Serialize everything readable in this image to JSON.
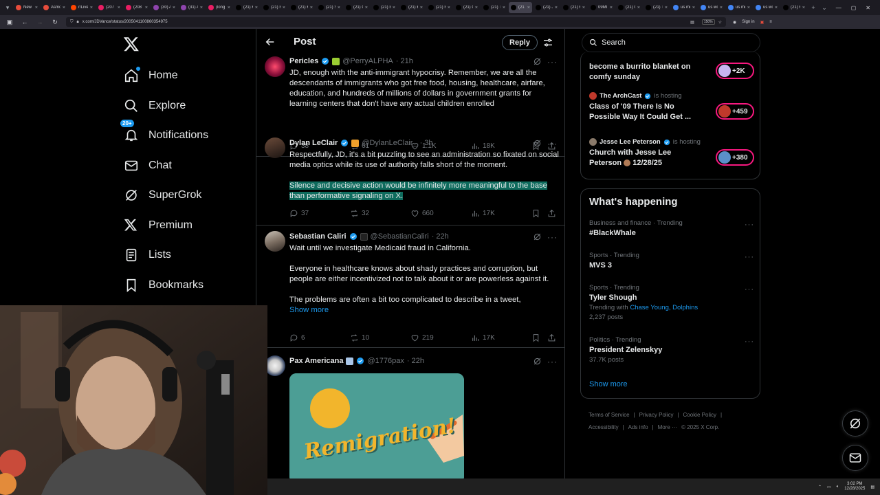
{
  "browser": {
    "tabs": [
      {
        "label": "New",
        "color": "#e74c3c"
      },
      {
        "label": "Asmo",
        "color": "#e74c3c"
      },
      {
        "label": "r/Live",
        "color": "#ff4500"
      },
      {
        "label": "(207",
        "color": "#e91e63"
      },
      {
        "label": "(208",
        "color": "#e91e63"
      },
      {
        "label": "(30) A",
        "color": "#8e44ad"
      },
      {
        "label": "(31) A",
        "color": "#8e44ad"
      },
      {
        "label": "(long",
        "color": "#e91e63"
      },
      {
        "label": "(21) F",
        "color": "#000000"
      },
      {
        "label": "(21) F",
        "color": "#000000"
      },
      {
        "label": "(21) F",
        "color": "#000000"
      },
      {
        "label": "(21) S",
        "color": "#000000"
      },
      {
        "label": "(21) G",
        "color": "#000000"
      },
      {
        "label": "(21) E",
        "color": "#000000"
      },
      {
        "label": "(21) E",
        "color": "#000000"
      },
      {
        "label": "(21) F",
        "color": "#000000"
      },
      {
        "label": "(21) G",
        "color": "#000000"
      },
      {
        "label": "(21) T",
        "color": "#000000"
      },
      {
        "label": "(21",
        "color": "#000000",
        "active": true
      },
      {
        "label": "(21) J",
        "color": "#000000"
      },
      {
        "label": "(21) F",
        "color": "#000000"
      },
      {
        "label": "09MI",
        "color": "#000000"
      },
      {
        "label": "(21) C",
        "color": "#000000"
      },
      {
        "label": "(21) T",
        "color": "#000000"
      },
      {
        "label": "us mi",
        "color": "#4285f4"
      },
      {
        "label": "us wo",
        "color": "#4285f4"
      },
      {
        "label": "us mi",
        "color": "#4285f4"
      },
      {
        "label": "us wo",
        "color": "#4285f4"
      },
      {
        "label": "(21) F",
        "color": "#000000"
      }
    ],
    "url": "x.com/JDVance/status/2005041100860354975",
    "zoom": "150%",
    "sign_in": "Sign in"
  },
  "sidebar": {
    "items": [
      {
        "label": "Home",
        "icon": "home-icon"
      },
      {
        "label": "Explore",
        "icon": "search-icon"
      },
      {
        "label": "Notifications",
        "icon": "bell-icon",
        "badge": "20+"
      },
      {
        "label": "Chat",
        "icon": "mail-icon"
      },
      {
        "label": "SuperGrok",
        "icon": "grok-icon"
      },
      {
        "label": "Premium",
        "icon": "x-icon"
      },
      {
        "label": "Lists",
        "icon": "list-icon"
      },
      {
        "label": "Bookmarks",
        "icon": "bookmark-icon"
      }
    ]
  },
  "main": {
    "title": "Post",
    "reply_label": "Reply",
    "tweets": [
      {
        "name": "Pericles",
        "handle": "@PerryALPHA",
        "time": "· 21h",
        "text": [
          "JD, enough with the anti-immigrant hypocrisy. Remember, we are all the descendants of immigrants who got free food, housing, healthcare, airfare, education, and hundreds of millions of dollars in government grants for learning centers that don't have any actual children enrolled"
        ],
        "replies": "38",
        "reposts": "61",
        "likes": "1.1K",
        "views": "18K"
      },
      {
        "name": "Dylan LeClair",
        "handle": "@DylanLeClair_",
        "time": "· 3h",
        "text": [
          "Respectfully, JD, it's a bit puzzling to see an administration so fixated on social media optics while its use of authority falls short of the moment."
        ],
        "highlight": "Silence and decisive action would be infinitely more meaningful to the base than performative signaling on X.",
        "replies": "37",
        "reposts": "32",
        "likes": "660",
        "views": "17K"
      },
      {
        "name": "Sebastian Caliri",
        "handle": "@SebastianCaliri",
        "time": "· 22h",
        "text": [
          "Wait until we investigate Medicaid fraud in California.",
          "Everyone in healthcare knows about shady practices and corruption, but people are either incentivized not to talk about it or are powerless against it.",
          "The problems are often a bit too complicated to describe in a tweet,"
        ],
        "show_more": "Show more",
        "replies": "6",
        "reposts": "10",
        "likes": "219",
        "views": "17K"
      },
      {
        "name": "Pax Americana",
        "handle": "@1776pax",
        "time": "· 22h",
        "image_text": "Remigration!"
      }
    ]
  },
  "right": {
    "search_placeholder": "Search",
    "spaces": [
      {
        "title": "become a burrito blanket on comfy sunday",
        "count": "+2K",
        "pill_color": "#c7b6f0"
      },
      {
        "host": "The ArchCast",
        "hosting": "is hosting",
        "title": "Class of '09 There Is No Possible Way It Could Get ...",
        "count": "+459",
        "pill_color": "#c0392b"
      },
      {
        "host": "Jesse Lee Peterson",
        "hosting": "is hosting",
        "title": "Church with Jesse Lee Peterson",
        "title_suffix": "12/28/25",
        "count": "+380",
        "pill_color": "#5b8fc9"
      }
    ],
    "happening_title": "What's happening",
    "trends": [
      {
        "category": "Business and finance · Trending",
        "name": "#BlackWhale"
      },
      {
        "category": "Sports · Trending",
        "name": "MVS 3"
      },
      {
        "category": "Sports · Trending",
        "name": "Tyler Shough",
        "sub_prefix": "Trending with",
        "sub_links": "Chase Young, Dolphins",
        "posts": "2,237 posts"
      },
      {
        "category": "Politics · Trending",
        "name": "President Zelenskyy",
        "posts": "37.7K posts"
      }
    ],
    "show_more": "Show more",
    "footer": [
      "Terms of Service",
      "|",
      "Privacy Policy",
      "|",
      "Cookie Policy",
      "|",
      "Accessibility",
      "|",
      "Ads info",
      "|",
      "More ···",
      "© 2025 X Corp."
    ]
  },
  "taskbar": {
    "time": "3:02 PM",
    "date": "12/28/2025"
  }
}
